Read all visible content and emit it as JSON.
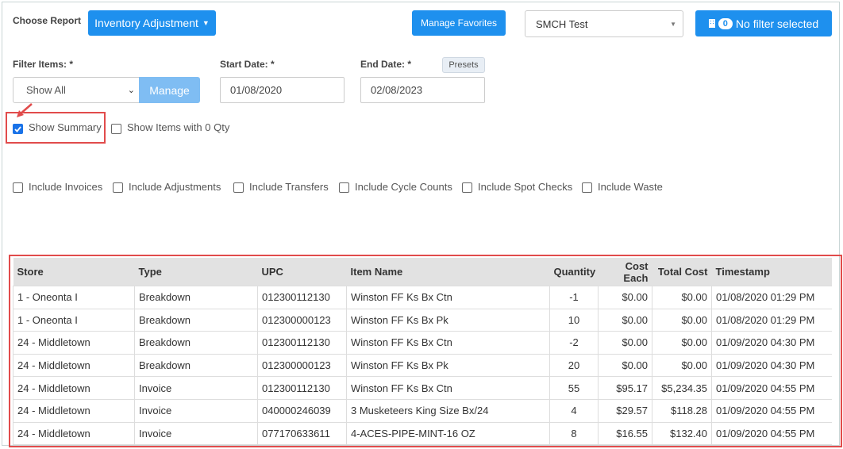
{
  "header": {
    "choose_report_label": "Choose Report",
    "report_dropdown": "Inventory Adjustment",
    "manage_favorites": "Manage Favorites",
    "store_select": "SMCH Test",
    "filter_count": "0",
    "filter_label": "No filter selected"
  },
  "filters": {
    "filter_items_label": "Filter Items: *",
    "filter_items_value": "Show All",
    "manage_button": "Manage",
    "start_date_label": "Start Date: *",
    "start_date_value": "01/08/2020",
    "end_date_label": "End Date: *",
    "presets_button": "Presets",
    "end_date_value": "02/08/2023"
  },
  "options": {
    "show_summary": "Show Summary",
    "show_zero_qty": "Show Items with 0 Qty",
    "include": [
      "Include Invoices",
      "Include Adjustments",
      "Include Transfers",
      "Include Cycle Counts",
      "Include Spot Checks",
      "Include Waste"
    ]
  },
  "table": {
    "columns": [
      "Store",
      "Type",
      "UPC",
      "Item Name",
      "Quantity",
      "Cost Each",
      "Total Cost",
      "Timestamp"
    ],
    "rows": [
      [
        "1 - Oneonta I",
        "Breakdown",
        "012300112130",
        "Winston FF Ks Bx Ctn",
        "-1",
        "$0.00",
        "$0.00",
        "01/08/2020 01:29 PM"
      ],
      [
        "1 - Oneonta I",
        "Breakdown",
        "012300000123",
        "Winston FF Ks Bx Pk",
        "10",
        "$0.00",
        "$0.00",
        "01/08/2020 01:29 PM"
      ],
      [
        "24 - Middletown",
        "Breakdown",
        "012300112130",
        "Winston FF Ks Bx Ctn",
        "-2",
        "$0.00",
        "$0.00",
        "01/09/2020 04:30 PM"
      ],
      [
        "24 - Middletown",
        "Breakdown",
        "012300000123",
        "Winston FF Ks Bx Pk",
        "20",
        "$0.00",
        "$0.00",
        "01/09/2020 04:30 PM"
      ],
      [
        "24 - Middletown",
        "Invoice",
        "012300112130",
        "Winston FF Ks Bx Ctn",
        "55",
        "$95.17",
        "$5,234.35",
        "01/09/2020 04:55 PM"
      ],
      [
        "24 - Middletown",
        "Invoice",
        "040000246039",
        "3 Musketeers King Size Bx/24",
        "4",
        "$29.57",
        "$118.28",
        "01/09/2020 04:55 PM"
      ],
      [
        "24 - Middletown",
        "Invoice",
        "077170633611",
        "4-ACES-PIPE-MINT-16 OZ",
        "8",
        "$16.55",
        "$132.40",
        "01/09/2020 04:55 PM"
      ]
    ]
  },
  "colors": {
    "accent": "#1e90ee",
    "highlight": "#e14b4b",
    "header_bg": "#e2e2e2"
  }
}
